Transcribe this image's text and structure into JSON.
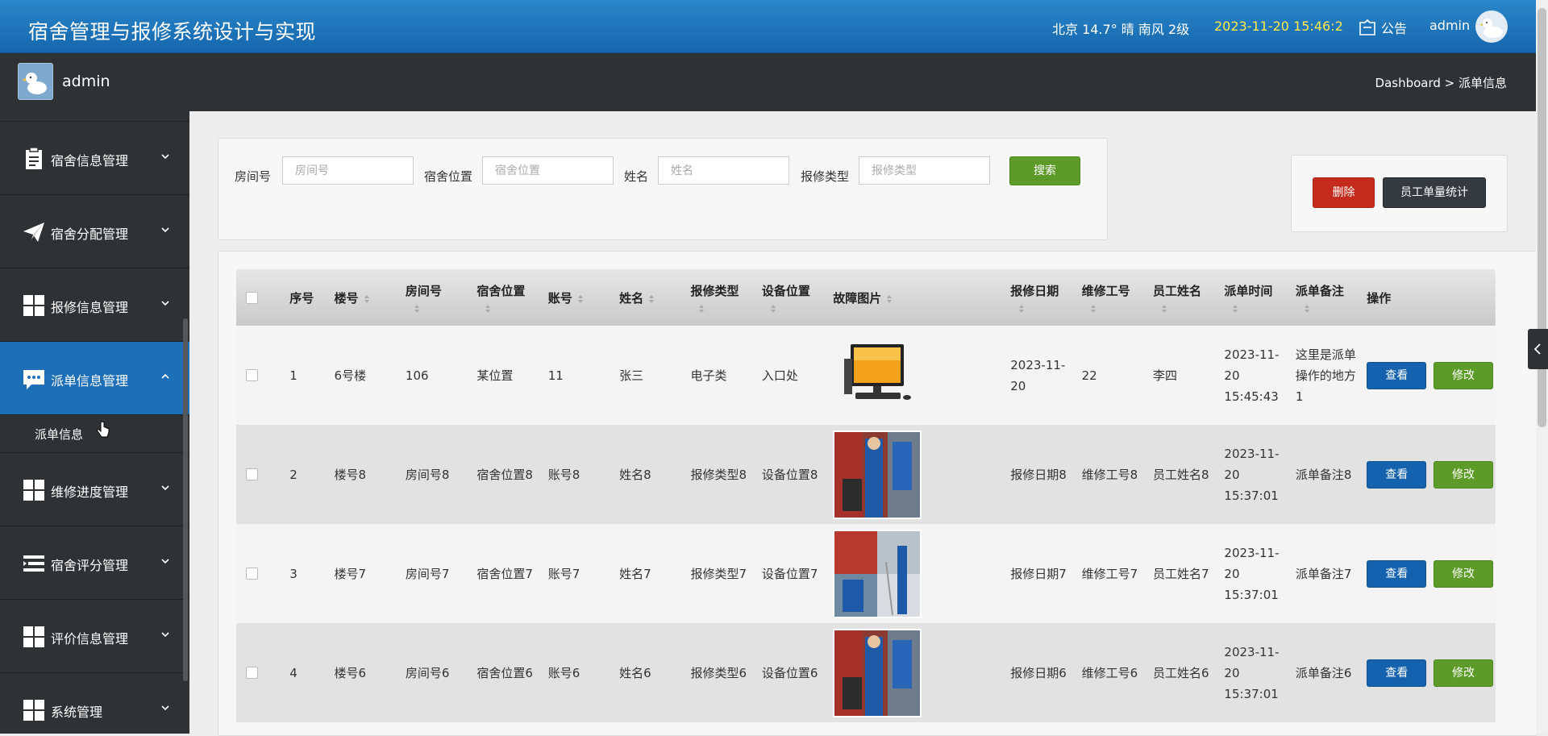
{
  "header": {
    "title": "宿舍管理与报修系统设计与实现",
    "weather": "北京  14.7°  晴  南风  2级",
    "datetime": "2023-11-20 15:46:2",
    "notice_label": "公告",
    "user": "admin"
  },
  "subbar": {
    "user": "admin",
    "breadcrumb": "Dashboard > 派单信息"
  },
  "sidebar": {
    "items": [
      {
        "label": "宿舍信息管理",
        "icon": "clipboard-icon"
      },
      {
        "label": "宿舍分配管理",
        "icon": "paper-plane-icon"
      },
      {
        "label": "报修信息管理",
        "icon": "grid-icon"
      },
      {
        "label": "派单信息管理",
        "icon": "chat-icon"
      },
      {
        "label": "维修进度管理",
        "icon": "grid-icon"
      },
      {
        "label": "宿舍评分管理",
        "icon": "list-icon"
      },
      {
        "label": "评价信息管理",
        "icon": "grid-icon"
      },
      {
        "label": "系统管理",
        "icon": "grid-icon"
      }
    ],
    "active_sub": "派单信息"
  },
  "search": {
    "room_label": "房间号",
    "room_placeholder": "房间号",
    "location_label": "宿舍位置",
    "location_placeholder": "宿舍位置",
    "name_label": "姓名",
    "name_placeholder": "姓名",
    "type_label": "报修类型",
    "type_placeholder": "报修类型",
    "button": "搜索"
  },
  "actions": {
    "delete": "删除",
    "stats": "员工单量统计"
  },
  "table": {
    "headers": {
      "index": "序号",
      "building": "楼号",
      "room": "房间号",
      "location": "宿舍位置",
      "account": "账号",
      "name": "姓名",
      "repair_type": "报修类型",
      "device_location": "设备位置",
      "fault_image": "故障图片",
      "repair_date": "报修日期",
      "worker_id": "维修工号",
      "worker_name": "员工姓名",
      "dispatch_time": "派单时间",
      "dispatch_note": "派单备注",
      "operation": "操作"
    },
    "view_label": "查看",
    "edit_label": "修改",
    "rows": [
      {
        "index": "1",
        "building": "6号楼",
        "room": "106",
        "location": "某位置",
        "account": "11",
        "name": "张三",
        "repair_type": "电子类",
        "device_location": "入口处",
        "image": "computer",
        "repair_date": "2023-11-20",
        "worker_id": "22",
        "worker_name": "李四",
        "dispatch_time": "2023-11-20 15:45:43",
        "dispatch_note": "这里是派单操作的地方1"
      },
      {
        "index": "2",
        "building": "楼号8",
        "room": "房间号8",
        "location": "宿舍位置8",
        "account": "账号8",
        "name": "姓名8",
        "repair_type": "报修类型8",
        "device_location": "设备位置8",
        "image": "repair-photo",
        "repair_date": "报修日期8",
        "worker_id": "维修工号8",
        "worker_name": "员工姓名8",
        "dispatch_time": "2023-11-20 15:37:01",
        "dispatch_note": "派单备注8"
      },
      {
        "index": "3",
        "building": "楼号7",
        "room": "房间号7",
        "location": "宿舍位置7",
        "account": "账号7",
        "name": "姓名7",
        "repair_type": "报修类型7",
        "device_location": "设备位置7",
        "image": "repair-photo",
        "repair_date": "报修日期7",
        "worker_id": "维修工号7",
        "worker_name": "员工姓名7",
        "dispatch_time": "2023-11-20 15:37:01",
        "dispatch_note": "派单备注7"
      },
      {
        "index": "4",
        "building": "楼号6",
        "room": "房间号6",
        "location": "宿舍位置6",
        "account": "账号6",
        "name": "姓名6",
        "repair_type": "报修类型6",
        "device_location": "设备位置6",
        "image": "repair-photo",
        "repair_date": "报修日期6",
        "worker_id": "维修工号6",
        "worker_name": "员工姓名6",
        "dispatch_time": "2023-11-20 15:37:01",
        "dispatch_note": "派单备注6"
      }
    ]
  },
  "colors": {
    "header_blue": "#1d6fb8",
    "active_nav": "#1d6fb8",
    "clock_yellow": "#ffec4a",
    "btn_green": "#5c9b27",
    "btn_red": "#c42b1c",
    "btn_blue": "#1462ad"
  }
}
